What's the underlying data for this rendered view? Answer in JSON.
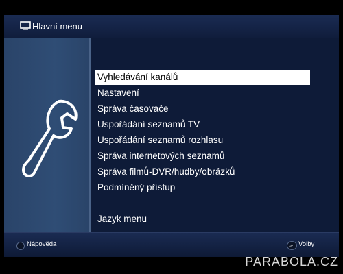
{
  "title_bar": {
    "icon": "tv-icon",
    "title": "Hlavní menu"
  },
  "side_panel": {
    "icon": "wrench-icon"
  },
  "menu": {
    "selected_index": 0,
    "items": [
      {
        "label": "Vyhledávání kanálů"
      },
      {
        "label": "Nastavení"
      },
      {
        "label": "Správa časovače"
      },
      {
        "label": "Uspořádání seznamů TV"
      },
      {
        "label": "Uspořádání seznamů rozhlasu"
      },
      {
        "label": "Správa internetových seznamů"
      },
      {
        "label": "Správa filmů-DVR/hudby/obrázků"
      },
      {
        "label": "Podmíněný přístup"
      },
      {
        "label": "Jazyk menu"
      }
    ]
  },
  "footer": {
    "help_label": "Nápověda",
    "options_key": "OPT",
    "options_label": "Volby"
  },
  "watermark": "PARABOLA.CZ",
  "colors": {
    "background": "#0e1b38",
    "side_panel": "#2f4d75",
    "selection": "#ffffff",
    "text": "#ffffff"
  }
}
